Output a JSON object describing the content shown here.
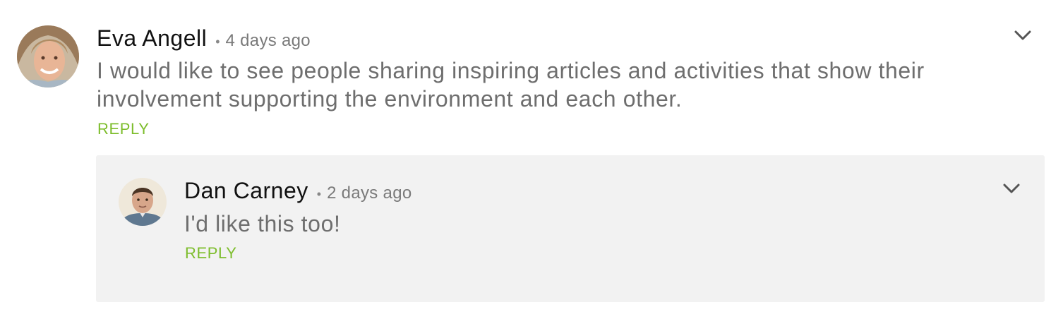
{
  "comments": [
    {
      "author": "Eva Angell",
      "separator": "•",
      "time": "4 days ago",
      "text_line1": "I would like to see people sharing inspiring articles and activities that show their",
      "text_line2": "involvement supporting the environment and each other.",
      "reply_label": "REPLY",
      "menu_icon": "chevron-down-icon"
    }
  ],
  "replies": [
    {
      "author": "Dan Carney",
      "separator": "•",
      "time": "2 days ago",
      "text": "I'd like this too!",
      "reply_label": "REPLY",
      "menu_icon": "chevron-down-icon"
    }
  ],
  "colors": {
    "reply_accent": "#7dbd2c",
    "reply_box_bg": "#f2f2f2",
    "body_text": "#6e6e6e"
  }
}
